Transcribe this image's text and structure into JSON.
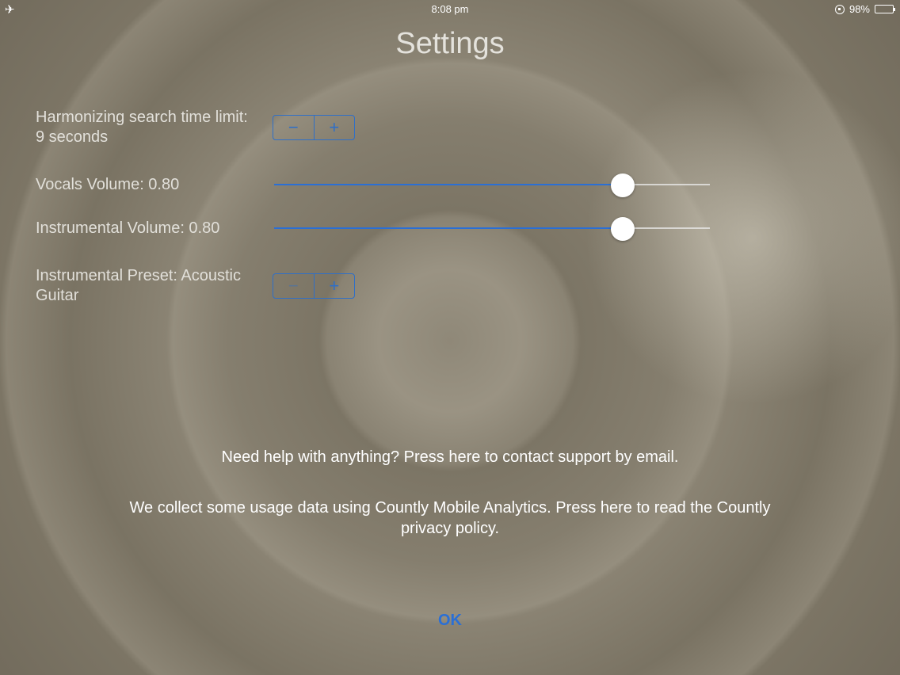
{
  "status_bar": {
    "airplane_icon": "airplane-icon",
    "time": "8:08 pm",
    "battery_percent": "98%",
    "battery_level": 0.98
  },
  "title": "Settings",
  "settings": {
    "search_time": {
      "label": "Harmonizing search time limit: 9 seconds",
      "minus": "−",
      "plus": "+"
    },
    "vocals_volume": {
      "label": "Vocals Volume: 0.80",
      "value": 0.8
    },
    "instrumental_volume": {
      "label": "Instrumental Volume: 0.80",
      "value": 0.8
    },
    "instrumental_preset": {
      "label": "Instrumental Preset: Acoustic Guitar",
      "minus": "−",
      "plus": "+"
    }
  },
  "support_text": "Need help with anything? Press here to contact support by email.",
  "privacy_text": "We collect some usage data using Countly Mobile Analytics. Press here to read the Countly privacy policy.",
  "ok_label": "OK",
  "colors": {
    "accent": "#2a6fd6",
    "text": "#e2e0da"
  }
}
